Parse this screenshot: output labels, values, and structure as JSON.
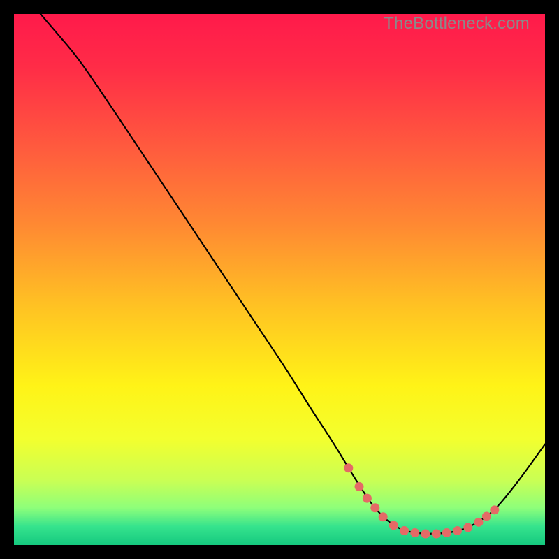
{
  "watermark": "TheBottleneck.com",
  "chart_data": {
    "type": "line",
    "title": "",
    "xlabel": "",
    "ylabel": "",
    "xlim": [
      0,
      100
    ],
    "ylim": [
      0,
      100
    ],
    "background_gradient": {
      "stops": [
        {
          "offset": 0.0,
          "color": "#ff1a4b"
        },
        {
          "offset": 0.1,
          "color": "#ff2c47"
        },
        {
          "offset": 0.25,
          "color": "#ff5a3e"
        },
        {
          "offset": 0.4,
          "color": "#ff8a32"
        },
        {
          "offset": 0.55,
          "color": "#ffc223"
        },
        {
          "offset": 0.7,
          "color": "#fff317"
        },
        {
          "offset": 0.8,
          "color": "#f3ff2e"
        },
        {
          "offset": 0.88,
          "color": "#c8ff55"
        },
        {
          "offset": 0.93,
          "color": "#8eff7a"
        },
        {
          "offset": 0.965,
          "color": "#36e38d"
        },
        {
          "offset": 1.0,
          "color": "#15c97f"
        }
      ]
    },
    "series": [
      {
        "name": "curve",
        "stroke": "#000000",
        "stroke_width": 2.2,
        "points_xy": [
          [
            5.0,
            100.0
          ],
          [
            8.0,
            96.5
          ],
          [
            12.0,
            91.8
          ],
          [
            17.0,
            84.5
          ],
          [
            22.0,
            77.0
          ],
          [
            27.0,
            69.5
          ],
          [
            32.0,
            62.0
          ],
          [
            37.0,
            54.5
          ],
          [
            42.0,
            47.0
          ],
          [
            47.0,
            39.5
          ],
          [
            52.0,
            32.0
          ],
          [
            56.0,
            25.5
          ],
          [
            60.0,
            19.5
          ],
          [
            63.0,
            14.5
          ],
          [
            65.5,
            10.5
          ],
          [
            67.5,
            7.5
          ],
          [
            69.5,
            5.3
          ],
          [
            71.5,
            3.7
          ],
          [
            73.5,
            2.7
          ],
          [
            76.0,
            2.2
          ],
          [
            79.0,
            2.1
          ],
          [
            82.0,
            2.3
          ],
          [
            84.5,
            2.9
          ],
          [
            86.5,
            3.8
          ],
          [
            88.5,
            5.0
          ],
          [
            90.5,
            6.6
          ],
          [
            93.0,
            9.5
          ],
          [
            96.0,
            13.4
          ],
          [
            100.0,
            19.0
          ]
        ]
      }
    ],
    "markers": {
      "name": "dots",
      "fill": "#e46a66",
      "radius": 6.5,
      "points_xy": [
        [
          63.0,
          14.5
        ],
        [
          65.0,
          11.0
        ],
        [
          66.5,
          8.8
        ],
        [
          68.0,
          7.0
        ],
        [
          69.5,
          5.3
        ],
        [
          71.5,
          3.7
        ],
        [
          73.5,
          2.7
        ],
        [
          75.5,
          2.3
        ],
        [
          77.5,
          2.1
        ],
        [
          79.5,
          2.1
        ],
        [
          81.5,
          2.3
        ],
        [
          83.5,
          2.7
        ],
        [
          85.5,
          3.3
        ],
        [
          87.5,
          4.3
        ],
        [
          89.0,
          5.4
        ],
        [
          90.5,
          6.6
        ]
      ]
    }
  }
}
